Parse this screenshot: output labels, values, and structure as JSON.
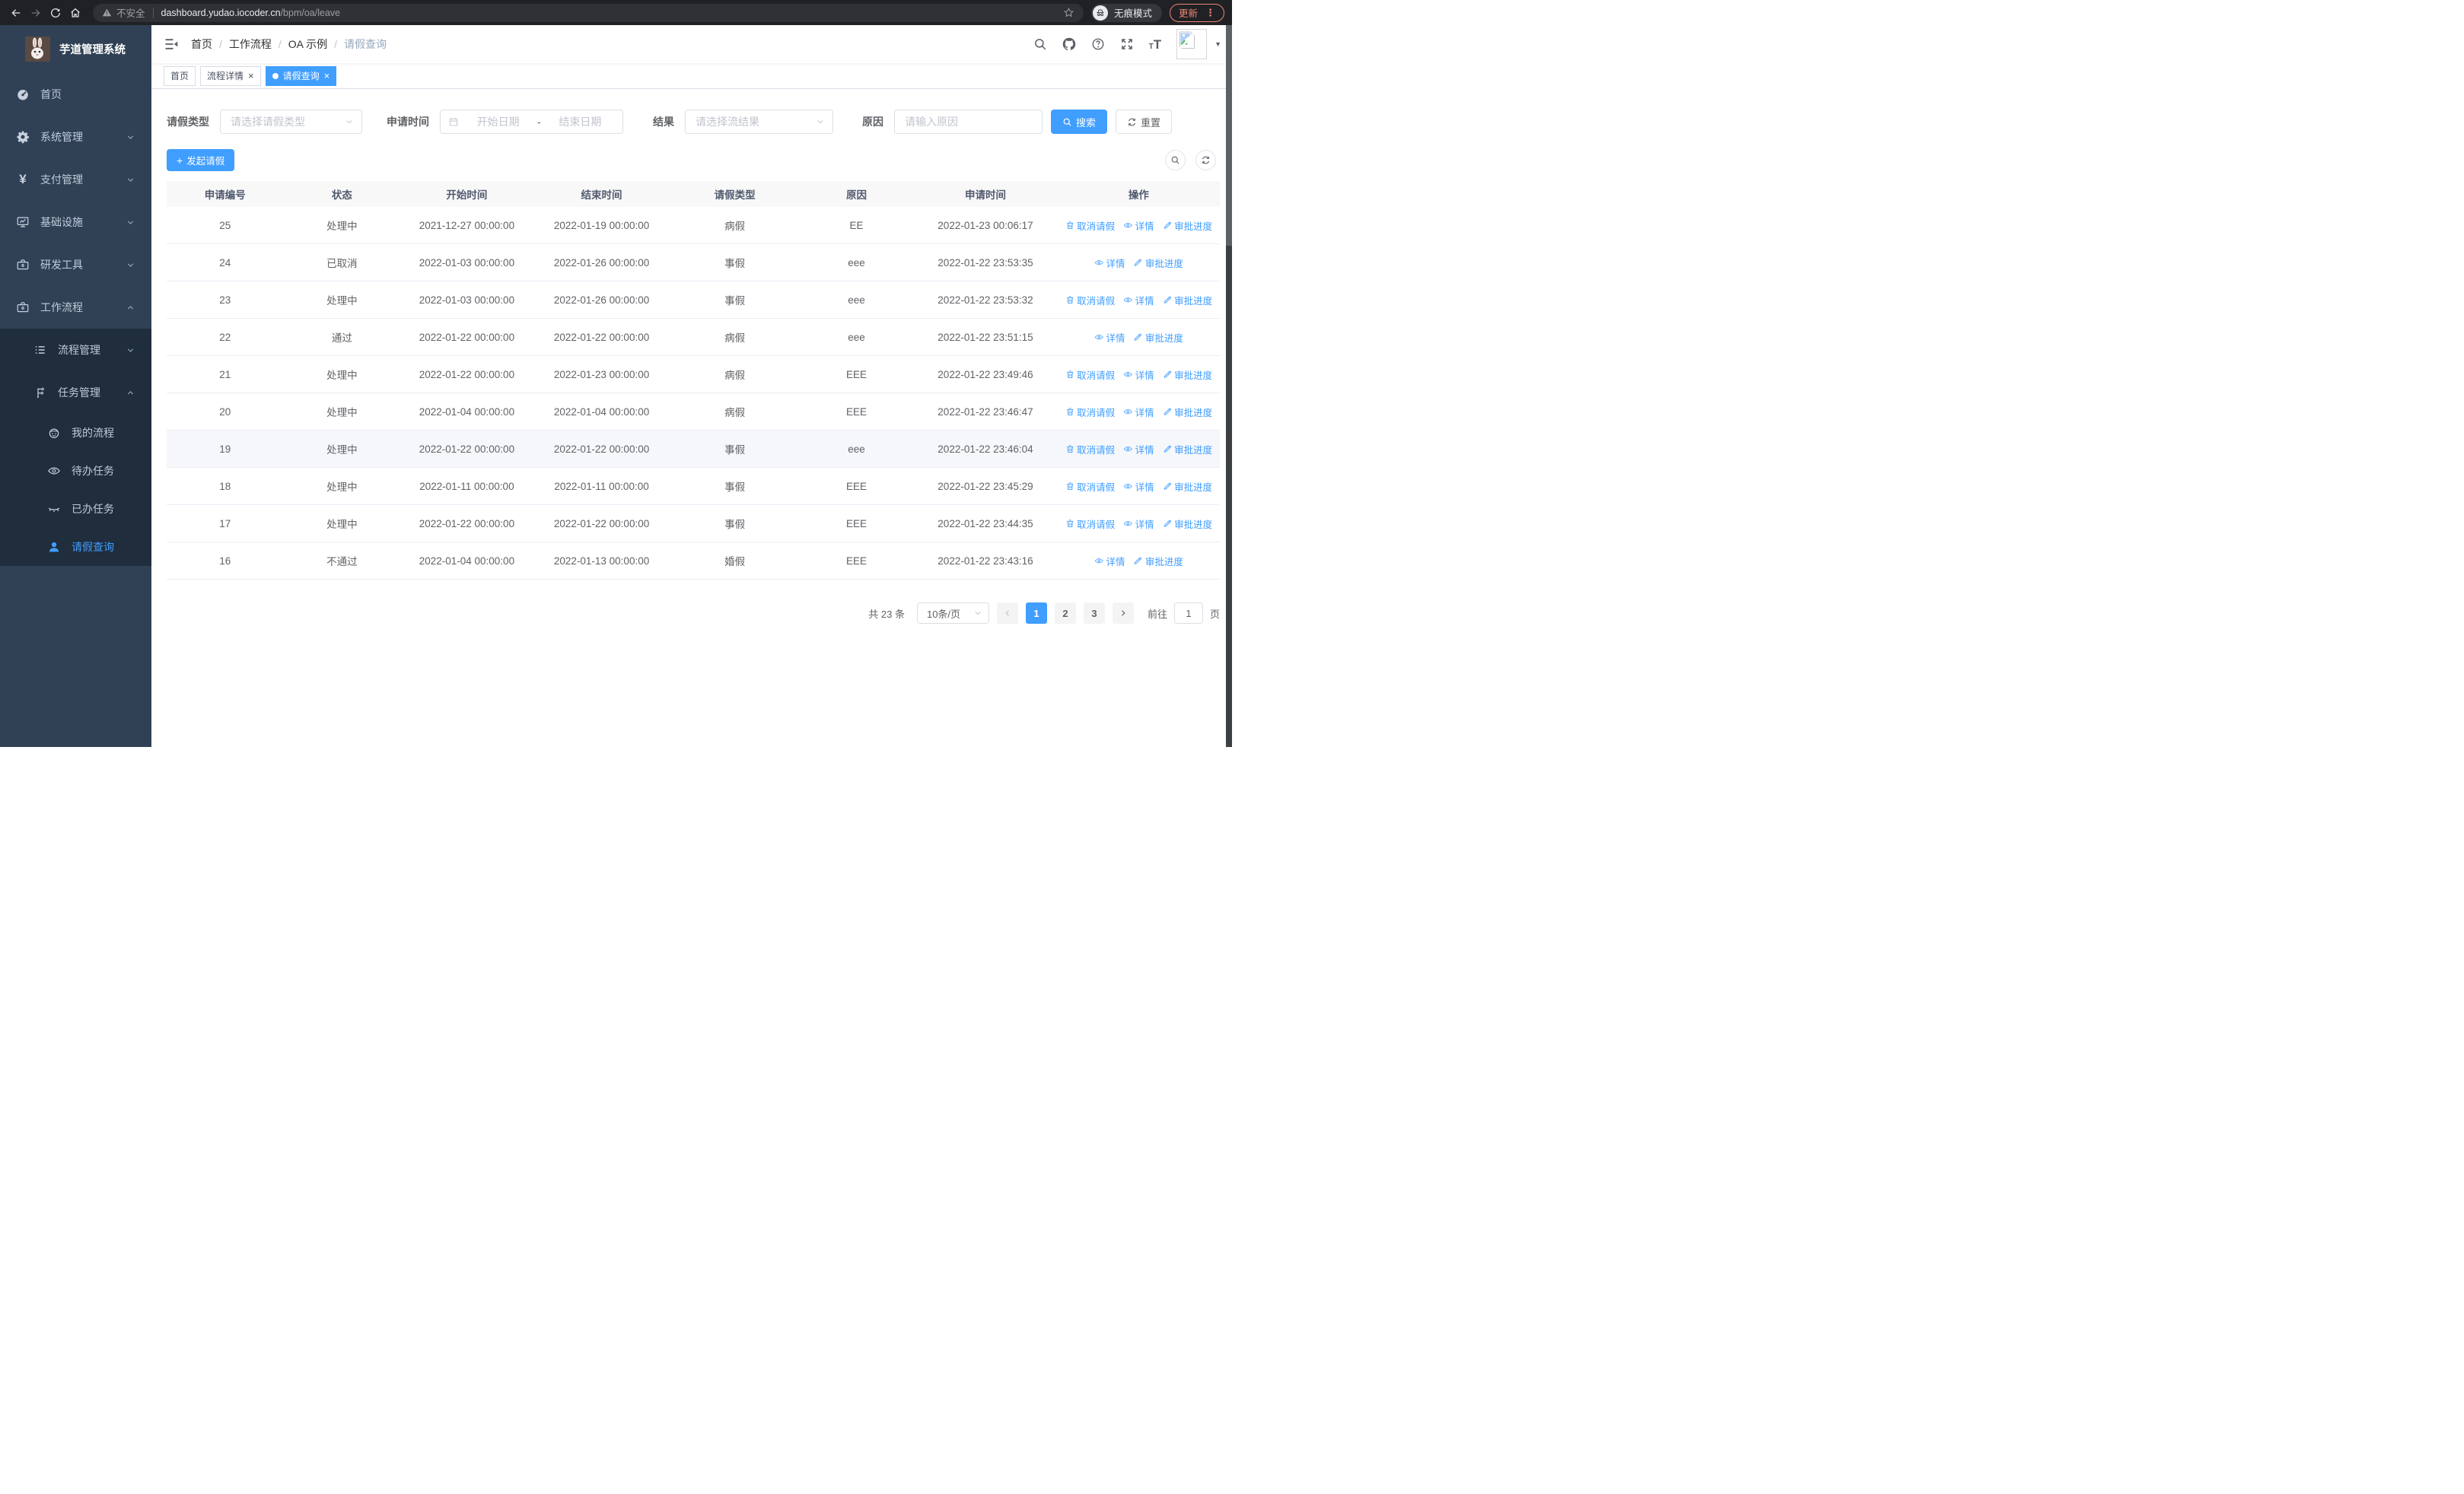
{
  "browser": {
    "security_label": "不安全",
    "url_host": "dashboard.yudao.iocoder.cn",
    "url_path": "/bpm/oa/leave",
    "incognito_label": "无痕模式",
    "update_label": "更新"
  },
  "colors": {
    "accent": "#409eff",
    "sidebar_bg": "#304156",
    "submenu_bg": "#1f2d3d"
  },
  "sidebar": {
    "title": "芋道管理系统",
    "items": [
      {
        "name": "home",
        "label": "首页",
        "icon": "dashboard",
        "indent": 1
      },
      {
        "name": "system",
        "label": "系统管理",
        "icon": "gear",
        "indent": 1,
        "arrow": "down"
      },
      {
        "name": "payment",
        "label": "支付管理",
        "icon": "yen",
        "indent": 1,
        "arrow": "down"
      },
      {
        "name": "infra",
        "label": "基础设施",
        "icon": "monitor",
        "indent": 1,
        "arrow": "down"
      },
      {
        "name": "devtools",
        "label": "研发工具",
        "icon": "toolbox",
        "indent": 1,
        "arrow": "down"
      },
      {
        "name": "workflow",
        "label": "工作流程",
        "icon": "toolbox",
        "indent": 1,
        "arrow": "up"
      },
      {
        "name": "process-mgmt",
        "label": "流程管理",
        "icon": "list",
        "indent": 2,
        "arrow": "down",
        "sub": true
      },
      {
        "name": "task-mgmt",
        "label": "任务管理",
        "icon": "tree",
        "indent": 2,
        "arrow": "up",
        "sub": true
      },
      {
        "name": "my-process",
        "label": "我的流程",
        "icon": "robot",
        "indent": 3,
        "sub": true
      },
      {
        "name": "todo-tasks",
        "label": "待办任务",
        "icon": "eye-open",
        "indent": 3,
        "sub": true
      },
      {
        "name": "done-tasks",
        "label": "已办任务",
        "icon": "eye-close",
        "indent": 3,
        "sub": true
      },
      {
        "name": "leave-query",
        "label": "请假查询",
        "icon": "user",
        "indent": 3,
        "sub": true,
        "active": true
      }
    ]
  },
  "breadcrumb": {
    "items": [
      "首页",
      "工作流程",
      "OA 示例",
      "请假查询"
    ],
    "separator": "/"
  },
  "tabs": [
    {
      "name": "home",
      "label": "首页",
      "closable": false,
      "active": false
    },
    {
      "name": "process-detail",
      "label": "流程详情",
      "closable": true,
      "active": false
    },
    {
      "name": "leave-query",
      "label": "请假查询",
      "closable": true,
      "active": true
    }
  ],
  "filters": {
    "leave_type": {
      "label": "请假类型",
      "placeholder": "请选择请假类型"
    },
    "apply_time": {
      "label": "申请时间",
      "start_placeholder": "开始日期",
      "separator": "-",
      "end_placeholder": "结束日期"
    },
    "result": {
      "label": "结果",
      "placeholder": "请选择流结果"
    },
    "reason": {
      "label": "原因",
      "placeholder": "请输入原因"
    },
    "search_label": "搜索",
    "reset_label": "重置"
  },
  "toolbar": {
    "create_label": "发起请假"
  },
  "table": {
    "columns": [
      {
        "key": "id",
        "label": "申请编号"
      },
      {
        "key": "status",
        "label": "状态"
      },
      {
        "key": "start",
        "label": "开始时间"
      },
      {
        "key": "end",
        "label": "结束时间"
      },
      {
        "key": "type",
        "label": "请假类型"
      },
      {
        "key": "reason",
        "label": "原因"
      },
      {
        "key": "apply",
        "label": "申请时间"
      },
      {
        "key": "op",
        "label": "操作"
      }
    ],
    "action_labels": {
      "cancel": "取消请假",
      "detail": "详情",
      "progress": "审批进度"
    },
    "rows": [
      {
        "id": "25",
        "status": "处理中",
        "start": "2021-12-27 00:00:00",
        "end": "2022-01-19 00:00:00",
        "type": "病假",
        "reason": "EE",
        "apply": "2022-01-23 00:06:17",
        "actions": [
          "cancel",
          "detail",
          "progress"
        ]
      },
      {
        "id": "24",
        "status": "已取消",
        "start": "2022-01-03 00:00:00",
        "end": "2022-01-26 00:00:00",
        "type": "事假",
        "reason": "eee",
        "apply": "2022-01-22 23:53:35",
        "actions": [
          "detail",
          "progress"
        ]
      },
      {
        "id": "23",
        "status": "处理中",
        "start": "2022-01-03 00:00:00",
        "end": "2022-01-26 00:00:00",
        "type": "事假",
        "reason": "eee",
        "apply": "2022-01-22 23:53:32",
        "actions": [
          "cancel",
          "detail",
          "progress"
        ]
      },
      {
        "id": "22",
        "status": "通过",
        "start": "2022-01-22 00:00:00",
        "end": "2022-01-22 00:00:00",
        "type": "病假",
        "reason": "eee",
        "apply": "2022-01-22 23:51:15",
        "actions": [
          "detail",
          "progress"
        ]
      },
      {
        "id": "21",
        "status": "处理中",
        "start": "2022-01-22 00:00:00",
        "end": "2022-01-23 00:00:00",
        "type": "病假",
        "reason": "EEE",
        "apply": "2022-01-22 23:49:46",
        "actions": [
          "cancel",
          "detail",
          "progress"
        ]
      },
      {
        "id": "20",
        "status": "处理中",
        "start": "2022-01-04 00:00:00",
        "end": "2022-01-04 00:00:00",
        "type": "病假",
        "reason": "EEE",
        "apply": "2022-01-22 23:46:47",
        "actions": [
          "cancel",
          "detail",
          "progress"
        ]
      },
      {
        "id": "19",
        "status": "处理中",
        "start": "2022-01-22 00:00:00",
        "end": "2022-01-22 00:00:00",
        "type": "事假",
        "reason": "eee",
        "apply": "2022-01-22 23:46:04",
        "actions": [
          "cancel",
          "detail",
          "progress"
        ],
        "highlight": true
      },
      {
        "id": "18",
        "status": "处理中",
        "start": "2022-01-11 00:00:00",
        "end": "2022-01-11 00:00:00",
        "type": "事假",
        "reason": "EEE",
        "apply": "2022-01-22 23:45:29",
        "actions": [
          "cancel",
          "detail",
          "progress"
        ]
      },
      {
        "id": "17",
        "status": "处理中",
        "start": "2022-01-22 00:00:00",
        "end": "2022-01-22 00:00:00",
        "type": "事假",
        "reason": "EEE",
        "apply": "2022-01-22 23:44:35",
        "actions": [
          "cancel",
          "detail",
          "progress"
        ]
      },
      {
        "id": "16",
        "status": "不通过",
        "start": "2022-01-04 00:00:00",
        "end": "2022-01-13 00:00:00",
        "type": "婚假",
        "reason": "EEE",
        "apply": "2022-01-22 23:43:16",
        "actions": [
          "detail",
          "progress"
        ]
      }
    ]
  },
  "pagination": {
    "total_label": "共 23 条",
    "page_size": "10条/页",
    "pages": [
      "1",
      "2",
      "3"
    ],
    "active_page": "1",
    "goto_label": "前往",
    "goto_value": "1",
    "unit_label": "页"
  }
}
